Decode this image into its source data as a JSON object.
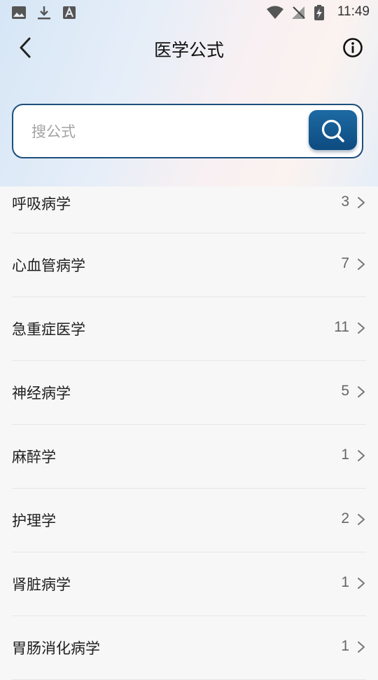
{
  "status_bar": {
    "time": "11:49",
    "left_icons": [
      "image-icon",
      "download-icon",
      "text-box-icon"
    ],
    "right_icons": [
      "wifi-icon",
      "no-signal-icon",
      "battery-charging-icon"
    ]
  },
  "header": {
    "title": "医学公式",
    "back_icon": "chevron-left-icon",
    "info_icon": "info-circle-icon"
  },
  "search": {
    "placeholder": "搜公式",
    "button_icon": "search-icon"
  },
  "categories": [
    {
      "label": "呼吸病学",
      "count": "3"
    },
    {
      "label": "心血管病学",
      "count": "7"
    },
    {
      "label": "急重症医学",
      "count": "11"
    },
    {
      "label": "神经病学",
      "count": "5"
    },
    {
      "label": "麻醉学",
      "count": "1"
    },
    {
      "label": "护理学",
      "count": "2"
    },
    {
      "label": "肾脏病学",
      "count": "1"
    },
    {
      "label": "胃肠消化病学",
      "count": "1"
    }
  ],
  "colors": {
    "accent": "#0f5a93",
    "search_border": "#1d4f7c",
    "background": "#f7f7f7"
  }
}
